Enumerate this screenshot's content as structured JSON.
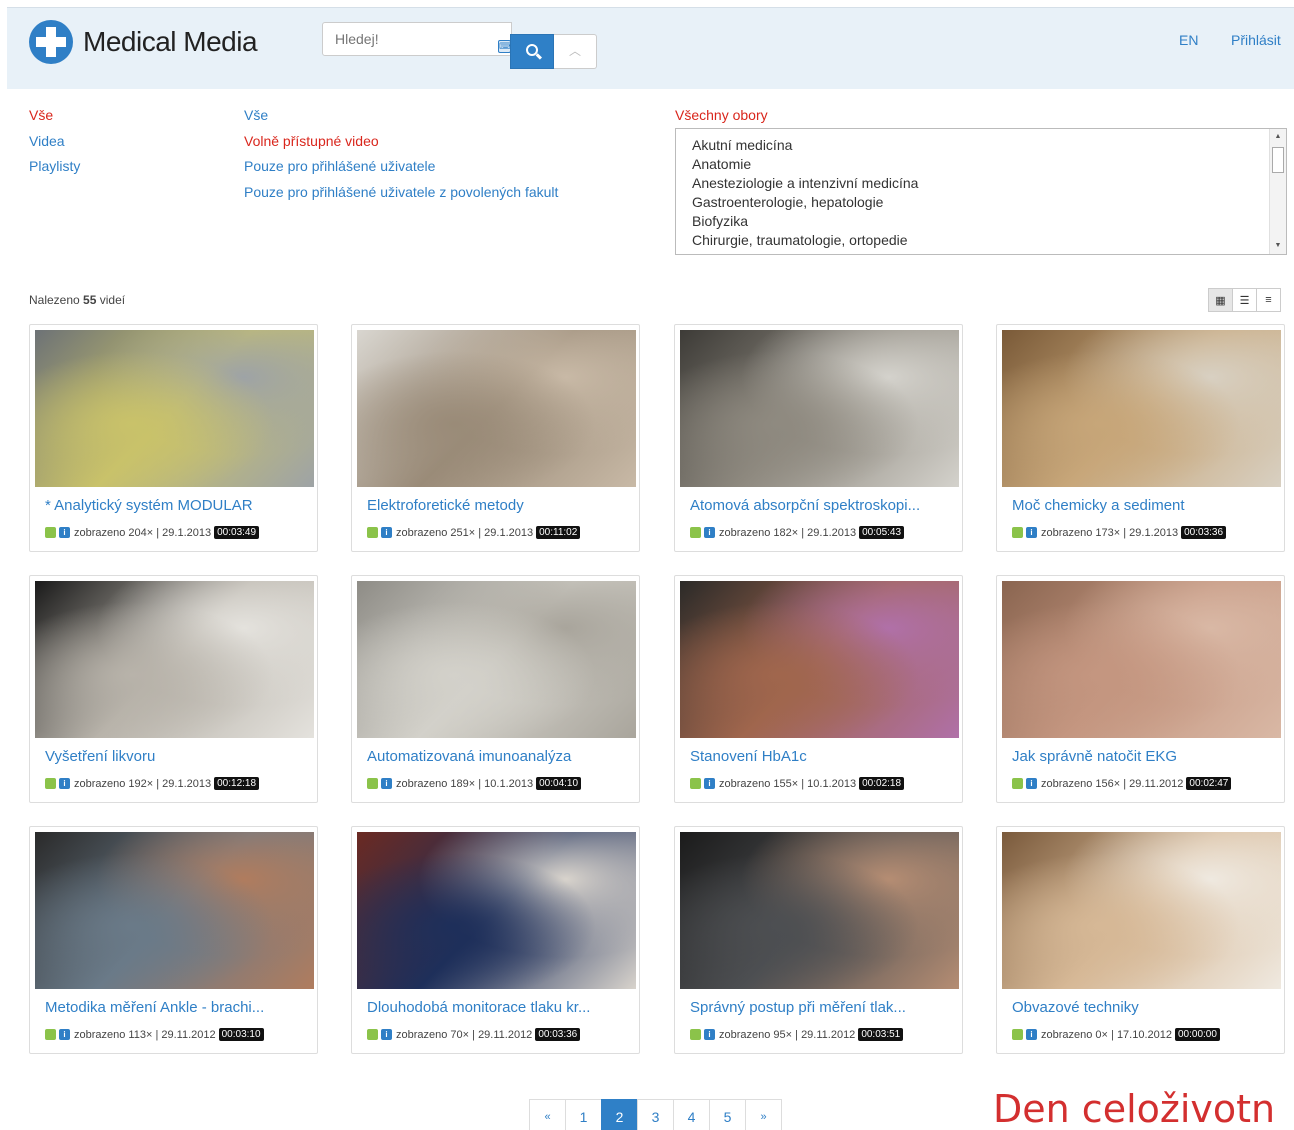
{
  "header": {
    "logo_text": "Medical Media",
    "search_placeholder": "Hledej!",
    "lang_link": "EN",
    "login_link": "Přihlásit"
  },
  "filters": {
    "type": {
      "items": [
        "Vše",
        "Videa",
        "Playlisty"
      ],
      "active": 0
    },
    "access": {
      "items": [
        "Vše",
        "Volně přístupné video",
        "Pouze pro přihlášené uživatele",
        "Pouze pro přihlášené uživatele z povolených fakult"
      ],
      "active": 1
    },
    "fields": {
      "title": "Všechny obory",
      "items": [
        "Akutní medicína",
        "Anatomie",
        "Anesteziologie a intenzivní medicína",
        "Gastroenterologie, hepatologie",
        "Biofyzika",
        "Chirurgie, traumatologie, ortopedie"
      ]
    }
  },
  "results": {
    "prefix": "Nalezeno",
    "count": "55",
    "suffix": "videí"
  },
  "videos": [
    {
      "title": "* Analytický systém MODULAR",
      "views": "zobrazeno 204×",
      "date": "| 29.1.2013",
      "duration": "00:03:49",
      "thumb": [
        "#6d7276",
        "#c9c26a",
        "#9ea3a6"
      ]
    },
    {
      "title": "Elektroforetické metody",
      "views": "zobrazeno 251×",
      "date": "| 29.1.2013",
      "duration": "00:11:02",
      "thumb": [
        "#d9d6d0",
        "#9a8b78",
        "#c8b9a6"
      ]
    },
    {
      "title": "Atomová absorpční spektroskopi...",
      "views": "zobrazeno 182×",
      "date": "| 29.1.2013",
      "duration": "00:05:43",
      "thumb": [
        "#3d3b37",
        "#8f8a80",
        "#d4d2cc"
      ]
    },
    {
      "title": "Moč chemicky a sediment",
      "views": "zobrazeno 173×",
      "date": "| 29.1.2013",
      "duration": "00:03:36",
      "thumb": [
        "#7a5a38",
        "#c7a679",
        "#d8d0c2"
      ]
    },
    {
      "title": "Vyšetření likvoru",
      "views": "zobrazeno 192×",
      "date": "| 29.1.2013",
      "duration": "00:12:18",
      "thumb": [
        "#1a1a1a",
        "#b8b3aa",
        "#e4e2dd"
      ]
    },
    {
      "title": "Automatizovaná imunoanalýza",
      "views": "zobrazeno 189×",
      "date": "| 10.1.2013",
      "duration": "00:04:10",
      "thumb": [
        "#8e8c86",
        "#d3d1ca",
        "#a9a59c"
      ]
    },
    {
      "title": "Stanovení HbA1c",
      "views": "zobrazeno 155×",
      "date": "| 10.1.2013",
      "duration": "00:02:18",
      "thumb": [
        "#2b2a28",
        "#a0664d",
        "#b070a8"
      ]
    },
    {
      "title": "Jak správně natočit EKG",
      "views": "zobrazeno 156×",
      "date": "| 29.11.2012",
      "duration": "00:02:47",
      "thumb": [
        "#8a6550",
        "#c49680",
        "#d9b8a5"
      ]
    },
    {
      "title": "Metodika měření Ankle - brachi...",
      "views": "zobrazeno 113×",
      "date": "| 29.11.2012",
      "duration": "00:03:10",
      "thumb": [
        "#2a2a2a",
        "#6a7a88",
        "#b07c5e"
      ]
    },
    {
      "title": "Dlouhodobá monitorace tlaku kr...",
      "views": "zobrazeno 70×",
      "date": "| 29.11.2012",
      "duration": "00:03:36",
      "thumb": [
        "#6b2a22",
        "#1e2f5a",
        "#d8d3cc"
      ]
    },
    {
      "title": "Správný postup při měření tlak...",
      "views": "zobrazeno 95×",
      "date": "| 29.11.2012",
      "duration": "00:03:51",
      "thumb": [
        "#1b1b1b",
        "#4d4f52",
        "#b58d73"
      ]
    },
    {
      "title": "Obvazové techniky",
      "views": "zobrazeno 0×",
      "date": "| 17.10.2012",
      "duration": "00:00:00",
      "thumb": [
        "#7a5a3c",
        "#d6b896",
        "#efe9e0"
      ]
    }
  ],
  "pager": {
    "prev": "«",
    "pages": [
      "1",
      "2",
      "3",
      "4",
      "5"
    ],
    "current": "2",
    "next": "»"
  },
  "footer_title": "Den celoživotn",
  "colors": {
    "accent": "#2f7fc6",
    "active": "#d9261c",
    "navbar": "#e8f1f8"
  }
}
